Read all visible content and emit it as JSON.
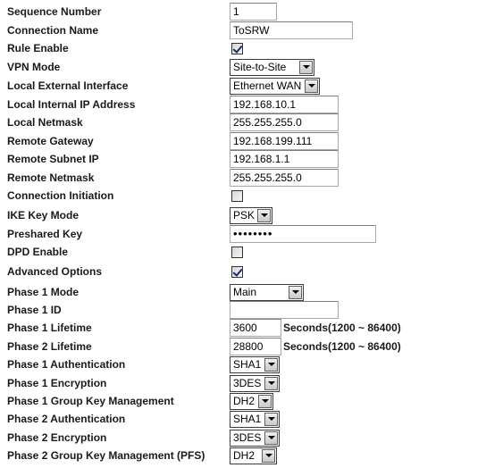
{
  "form": {
    "sequence_number": {
      "label": "Sequence Number",
      "value": "1"
    },
    "connection_name": {
      "label": "Connection Name",
      "value": "ToSRW"
    },
    "rule_enable": {
      "label": "Rule Enable",
      "checked": true
    },
    "vpn_mode": {
      "label": "VPN Mode",
      "value": "Site-to-Site"
    },
    "local_external_interface": {
      "label": "Local External Interface",
      "value": "Ethernet WAN"
    },
    "local_internal_ip": {
      "label": "Local Internal IP Address",
      "value": "192.168.10.1"
    },
    "local_netmask": {
      "label": "Local Netmask",
      "value": "255.255.255.0"
    },
    "remote_gateway": {
      "label": "Remote Gateway",
      "value": "192.168.199.111"
    },
    "remote_subnet_ip": {
      "label": "Remote Subnet IP",
      "value": "192.168.1.1"
    },
    "remote_netmask": {
      "label": "Remote Netmask",
      "value": "255.255.255.0"
    },
    "connection_initiation": {
      "label": "Connection Initiation",
      "checked": false
    },
    "ike_key_mode": {
      "label": "IKE Key Mode",
      "value": "PSK"
    },
    "preshared_key": {
      "label": "Preshared Key",
      "value": "••••••••"
    },
    "dpd_enable": {
      "label": "DPD Enable",
      "checked": false
    },
    "advanced_options": {
      "label": "Advanced Options",
      "checked": true
    },
    "phase1_mode": {
      "label": "Phase 1 Mode",
      "value": "Main"
    },
    "phase1_id": {
      "label": "Phase 1 ID",
      "value": ""
    },
    "phase1_lifetime": {
      "label": "Phase 1 Lifetime",
      "value": "3600",
      "hint": "Seconds(1200 ~ 86400)"
    },
    "phase2_lifetime": {
      "label": "Phase 2 Lifetime",
      "value": "28800",
      "hint": "Seconds(1200 ~ 86400)"
    },
    "phase1_auth": {
      "label": "Phase 1 Authentication",
      "value": "SHA1"
    },
    "phase1_enc": {
      "label": "Phase 1 Encryption",
      "value": "3DES"
    },
    "phase1_group": {
      "label": "Phase 1 Group Key Management",
      "value": "DH2"
    },
    "phase2_auth": {
      "label": "Phase 2 Authentication",
      "value": "SHA1"
    },
    "phase2_enc": {
      "label": "Phase 2 Encryption",
      "value": "3DES"
    },
    "phase2_group": {
      "label": "Phase 2 Group Key Management (PFS)",
      "value": "DH2"
    }
  }
}
